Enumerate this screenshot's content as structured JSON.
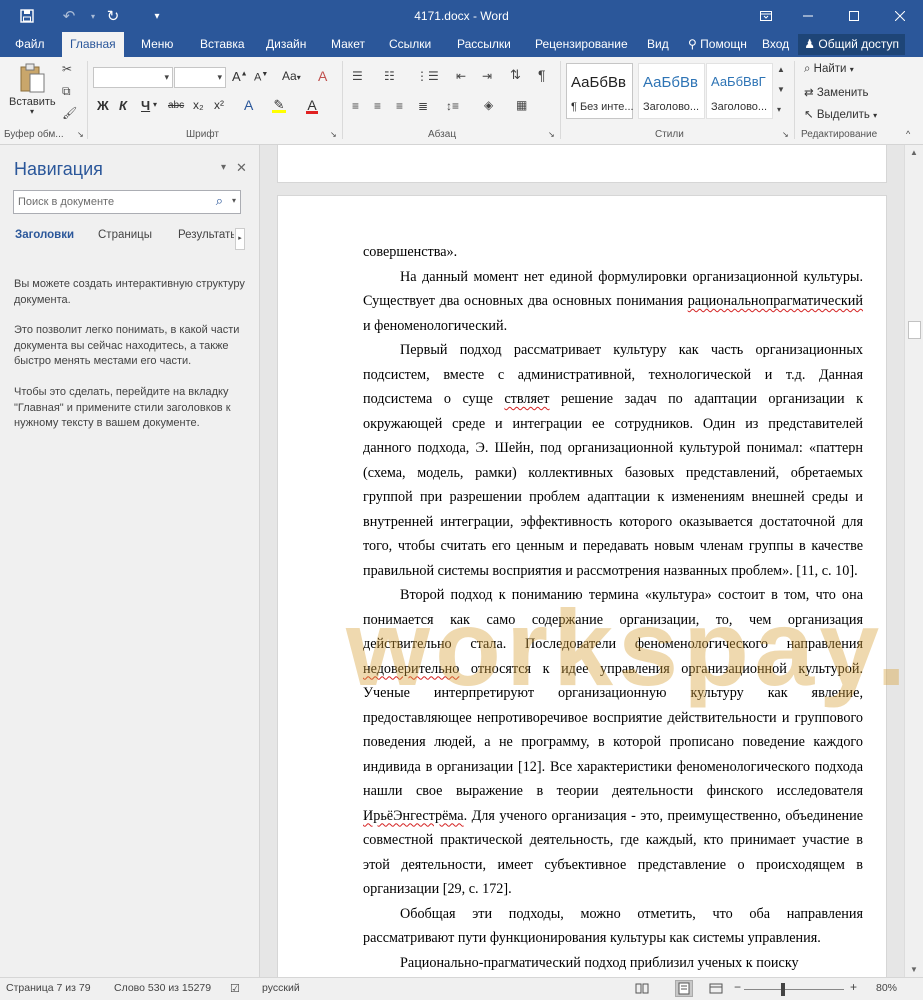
{
  "title_bar": {
    "title": "4171.docx - Word",
    "icons": [
      "save-icon",
      "undo-icon",
      "redo-icon",
      "customize-icon",
      "ribbon-display-icon",
      "minimize-icon",
      "maximize-icon",
      "close-icon"
    ]
  },
  "menu": {
    "tabs": [
      "Файл",
      "Главная",
      "Меню",
      "Вставка",
      "Дизайн",
      "Макет",
      "Ссылки",
      "Рассылки",
      "Рецензирование",
      "Вид"
    ],
    "active_tab": "Главная",
    "help": "Помощн",
    "signin": "Вход",
    "share": "Общий доступ"
  },
  "ribbon": {
    "clipboard": {
      "paste": "Вставить",
      "label": "Буфер обм..."
    },
    "font": {
      "label": "Шрифт",
      "font_name": "",
      "font_size": "",
      "grow": "A",
      "shrink": "A",
      "case": "Aa",
      "bold": "Ж",
      "italic": "К",
      "underline": "Ч",
      "strike": "abc",
      "subscript": "x₂",
      "superscript": "x²"
    },
    "paragraph": {
      "label": "Абзац"
    },
    "styles": {
      "label": "Стили",
      "items": [
        {
          "sample": "АаБбВв",
          "name": "¶ Без инте..."
        },
        {
          "sample": "АаБбВв",
          "name": "Заголово..."
        },
        {
          "sample": "АаБбВвГ",
          "name": "Заголово..."
        }
      ]
    },
    "editing": {
      "label": "Редактирование",
      "find": "Найти",
      "replace": "Заменить",
      "select": "Выделить"
    }
  },
  "navigation": {
    "title": "Навигация",
    "search_placeholder": "Поиск в документе",
    "tabs": [
      "Заголовки",
      "Страницы",
      "Результать"
    ],
    "help_text": [
      "Вы можете создать интерактивную структуру документа.",
      "Это позволит легко понимать, в какой части документа вы сейчас находитесь, а также быстро менять местами его части.",
      "Чтобы это сделать, перейдите на вкладку \"Главная\" и примените стили заголовков к нужному тексту в вашем документе."
    ]
  },
  "document": {
    "watermark": "workspay.ru",
    "paragraphs": [
      {
        "text": "совершенства».",
        "indent": false
      },
      {
        "text": "На данный момент нет единой формулировки организационной культуры. Существует два основных два основных понимания рациональнопрагматический и феноменологический.",
        "indent": true
      },
      {
        "text": "Первый подход рассматривает культуру как часть организационных подсистем, вместе с административной, технологической и т.д. Данная подсистема о суще ствляет решение задач по адаптации организации к окружающей среде и интеграции ее сотрудников. Один из представителей данного подхода, Э. Шейн, под организационной культурой понимал: «паттерн (схема, модель, рамки) коллективных базовых представлений, обретаемых группой при разрешении проблем адаптации к изменениям внешней среды и внутренней интеграции, эффективность которого оказывается достаточной для того, чтобы считать его ценным и передавать новым членам группы в качестве правильной системы восприятия и рассмотрения названных проблем». [11, с. 10].",
        "indent": true
      },
      {
        "text": "Второй подход к пониманию термина «культура» состоит в том, что она понимается как само содержание организации, то, чем организация действительно стала. Последователи феноменологического направления недоверительно относятся к идее управления организационной культурой. Ученые интерпретируют организационную культуру как явление, предоставляющее непротиворечивое восприятие действительности и группового поведения людей, а не программу, в которой прописано поведение каждого индивида в организации [12]. Все характеристики феноменологического подхода нашли свое выражение в теории деятельности финского исследователя ИрьёЭнгестрёма. Для ученого организация - это, преимущественно, объединение совместной практической деятельность, где каждый, кто принимает участие в этой деятельности, имеет субъективное представление о происходящем в организации [29, с. 172].",
        "indent": true
      },
      {
        "text": "Обобщая эти подходы, можно отметить, что оба направления рассматривают пути функционирования культуры как системы управления.",
        "indent": true
      },
      {
        "text": "Рационально-прагматический подход приблизил ученых к поиску",
        "indent": true
      }
    ]
  },
  "status_bar": {
    "page": "Страница 7 из 79",
    "words": "Слово 530 из 15279",
    "language": "русский",
    "zoom": "80%",
    "zoom_level": 0.8
  }
}
